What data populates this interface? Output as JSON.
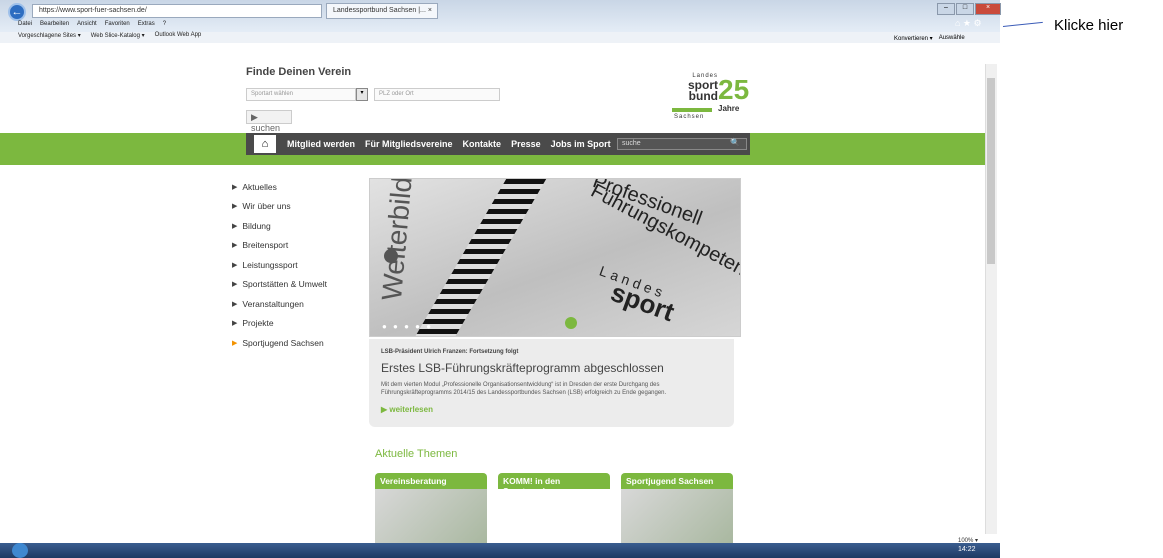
{
  "browser": {
    "address": "https://www.sport-fuer-sachsen.de/",
    "tab_title": "Landessportbund Sachsen |... ×",
    "menu": [
      "Datei",
      "Bearbeiten",
      "Ansicht",
      "Favoriten",
      "Extras",
      "?"
    ],
    "favorites": [
      "Vorgeschlagene Sites ▾",
      "Web Slice-Katalog ▾",
      "Outlook Web App"
    ],
    "toolbar_right": [
      "Konvertieren ▾",
      "Auswähle"
    ],
    "zoom": "100% ▾"
  },
  "annotation": {
    "callout": "Klicke hier"
  },
  "site": {
    "search_title": "Finde Deinen Verein",
    "sportart_placeholder": "Sportart wählen",
    "plz_placeholder": "PLZ oder Ort",
    "search_button": "▶ suchen",
    "logo": {
      "line1": "Landes",
      "line2": "sport",
      "line3": "bund",
      "line4": "Sachsen",
      "number": "25",
      "jahre": "Jahre"
    },
    "nav": [
      "Mitglied werden",
      "Für Mitgliedsvereine",
      "Kontakte",
      "Presse",
      "Jobs im Sport"
    ],
    "nav_search_placeholder": "suche",
    "sidebar": [
      "Aktuelles",
      "Wir über uns",
      "Bildung",
      "Breitensport",
      "Leistungssport",
      "Sportstätten & Umwelt",
      "Veranstaltungen",
      "Projekte",
      "Sportjugend Sachsen"
    ],
    "slider": {
      "text_weiter": "Weiterbildu",
      "text_prof": "Professionell",
      "text_fuehr": "Führungskompeten",
      "text_landes": "Landes",
      "text_sport": "sport",
      "dots": "● ● ● ● ●"
    },
    "news": {
      "kicker": "LSB-Präsident Ulrich Franzen: Fortsetzung folgt",
      "title": "Erstes LSB-Führungskräfteprogramm abgeschlossen",
      "text": "Mit dem vierten Modul „Professionelle Organisationsentwicklung“ ist in Dresden der erste Durchgang des Führungskräfteprogramms 2014/15 des Landessportbundes Sachsen (LSB) erfolgreich zu Ende gegangen.",
      "more": "▶ weiterlesen"
    },
    "themen_title": "Aktuelle Themen",
    "cards": [
      "Vereinsberatung",
      "KOMM! in den Sportverein",
      "Sportjugend Sachsen"
    ]
  },
  "taskbar": {
    "time": "14:22"
  }
}
